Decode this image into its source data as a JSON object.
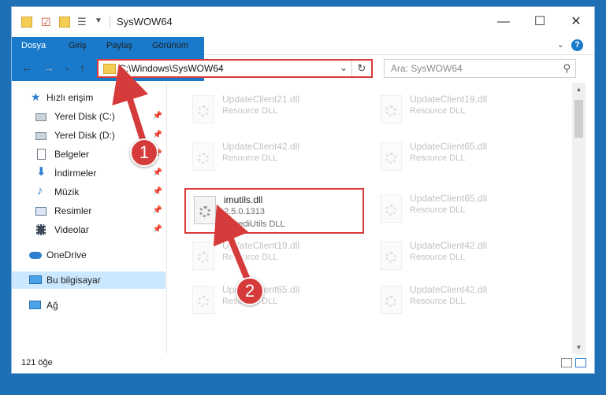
{
  "window": {
    "title": "SysWOW64"
  },
  "ribbon": {
    "tabs": [
      "Dosya",
      "Giriş",
      "Paylaş",
      "Görünüm"
    ]
  },
  "address": {
    "path": "C:\\Windows\\SysWOW64"
  },
  "search": {
    "placeholder": "Ara: SysWOW64"
  },
  "sidebar": {
    "items": [
      {
        "label": "Hızlı erişim",
        "icon": "star-icon",
        "pinned": false
      },
      {
        "label": "Yerel Disk (C:)",
        "icon": "drive-icon",
        "pinned": true
      },
      {
        "label": "Yerel Disk (D:)",
        "icon": "drive-icon",
        "pinned": true
      },
      {
        "label": "Belgeler",
        "icon": "document-icon",
        "pinned": true
      },
      {
        "label": "İndirmeler",
        "icon": "download-icon",
        "pinned": true
      },
      {
        "label": "Müzik",
        "icon": "music-icon",
        "pinned": true
      },
      {
        "label": "Resimler",
        "icon": "pictures-icon",
        "pinned": true
      },
      {
        "label": "Videolar",
        "icon": "video-icon",
        "pinned": true
      },
      {
        "label": "OneDrive",
        "icon": "cloud-icon",
        "pinned": false
      },
      {
        "label": "Bu bilgisayar",
        "icon": "computer-icon",
        "pinned": false,
        "selected": true
      },
      {
        "label": "Ağ",
        "icon": "network-icon",
        "pinned": false
      }
    ]
  },
  "files": [
    {
      "name": "UpdateClient21.dll",
      "desc": "Resource DLL",
      "faded": true
    },
    {
      "name": "UpdateClient19.dll",
      "desc": "Resource DLL",
      "faded": true
    },
    {
      "name": "UpdateClient42.dll",
      "desc": "Resource DLL",
      "faded": true
    },
    {
      "name": "UpdateClient65.dll",
      "desc": "Resource DLL",
      "faded": true
    },
    {
      "name": "imutils.dll",
      "version": "2.5.0.1313",
      "desc": "IncrediUtils DLL",
      "highlighted": true
    },
    {
      "name": "UpdateClient65.dll",
      "desc": "Resource DLL",
      "faded": true
    },
    {
      "name": "UpdateClient19.dll",
      "desc": "Resource DLL",
      "faded": true
    },
    {
      "name": "UpdateClient42.dll",
      "desc": "Resource DLL",
      "faded": true
    },
    {
      "name": "UpdateClient65.dll",
      "desc": "Resource DLL",
      "faded": true
    },
    {
      "name": "UpdateClient42.dll",
      "desc": "Resource DLL",
      "faded": true
    }
  ],
  "status": {
    "count": "121 öğe"
  },
  "annotations": {
    "step1": "1",
    "step2": "2",
    "color": "#d63b3b"
  },
  "colors": {
    "accent": "#1979ca",
    "highlight_border": "#d93a3a",
    "selected_bg": "#cce8ff"
  }
}
